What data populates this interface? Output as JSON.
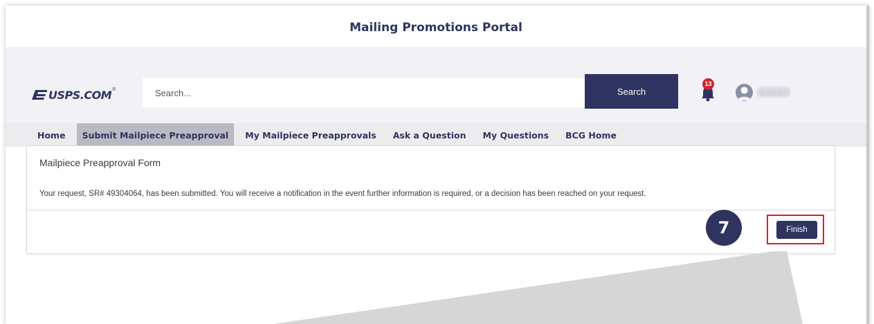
{
  "page": {
    "title": "Mailing Promotions Portal"
  },
  "header": {
    "logo_text": "USPS.COM",
    "logo_tm": "®",
    "search_placeholder": "Search...",
    "search_button_label": "Search",
    "notification_count": "13",
    "username": "d.tonbo"
  },
  "nav": {
    "items": [
      {
        "label": "Home"
      },
      {
        "label": "Submit Mailpiece Preapproval",
        "active": true
      },
      {
        "label": "My Mailpiece Preapprovals"
      },
      {
        "label": "Ask a Question"
      },
      {
        "label": "My Questions"
      },
      {
        "label": "BCG Home"
      }
    ]
  },
  "form": {
    "title": "Mailpiece Preapproval Form",
    "message": "Your request, SR# 49304064, has been submitted. You will receive a notification in the event further information is required, or a decision has been reached on your request.",
    "finish_label": "Finish"
  },
  "annotation": {
    "step_number": "7"
  },
  "icons": {
    "logo": "usps-eagle-icon",
    "bell": "bell-icon",
    "avatar": "user-avatar-icon"
  },
  "colors": {
    "brand_navy": "#2f3360",
    "highlight_red": "#e21b22",
    "badge_red": "#d0262f",
    "header_band": "#f1f1f6",
    "nav_active": "#b9b9c1"
  }
}
